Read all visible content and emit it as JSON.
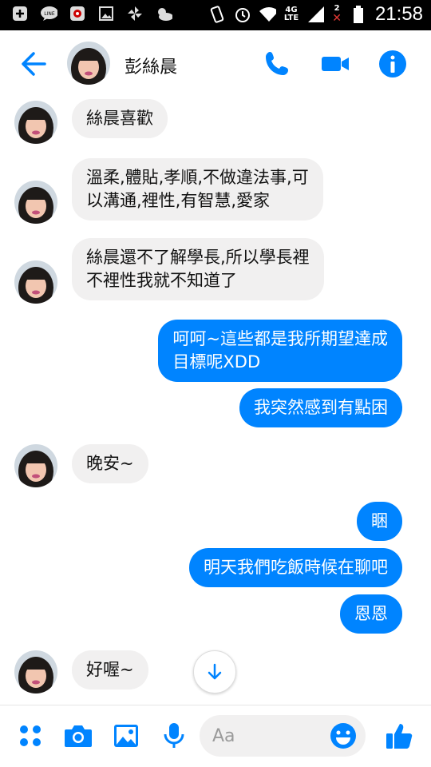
{
  "status_bar": {
    "time": "21:58",
    "network": "4G",
    "network_sub": "LTE",
    "sim_slot": "2"
  },
  "header": {
    "contact_name": "彭絲晨",
    "icons": [
      "back-arrow-icon",
      "phone-icon",
      "video-camera-icon",
      "info-icon"
    ]
  },
  "messages": [
    {
      "dir": "in",
      "lines": [
        "絲晨喜歡"
      ]
    },
    {
      "dir": "in",
      "lines": [
        "溫柔,體貼,孝順,不做違法事,可",
        "以溝通,裡性,有智慧,愛家"
      ]
    },
    {
      "dir": "in",
      "lines": [
        "絲晨還不了解學長,所以學長裡",
        "不裡性我就不知道了"
      ]
    },
    {
      "dir": "out",
      "lines": [
        "呵呵~這些都是我所期望達成",
        "目標呢XDD"
      ]
    },
    {
      "dir": "out",
      "lines": [
        "我突然感到有點困"
      ]
    },
    {
      "dir": "in",
      "lines": [
        "晚安~"
      ]
    },
    {
      "dir": "out",
      "lines": [
        "睏"
      ]
    },
    {
      "dir": "out",
      "lines": [
        "明天我們吃飯時候在聊吧"
      ]
    },
    {
      "dir": "out",
      "lines": [
        "恩恩"
      ]
    },
    {
      "dir": "in",
      "lines": [
        "好喔~"
      ]
    }
  ],
  "composer": {
    "placeholder": "Aa",
    "icons": [
      "more-dots-icon",
      "camera-icon",
      "gallery-icon",
      "microphone-icon",
      "emoji-icon",
      "thumbs-up-icon"
    ]
  },
  "colors": {
    "accent": "#0084ff",
    "incoming_bubble": "#f1f0f0",
    "status_bar": "#000000"
  }
}
